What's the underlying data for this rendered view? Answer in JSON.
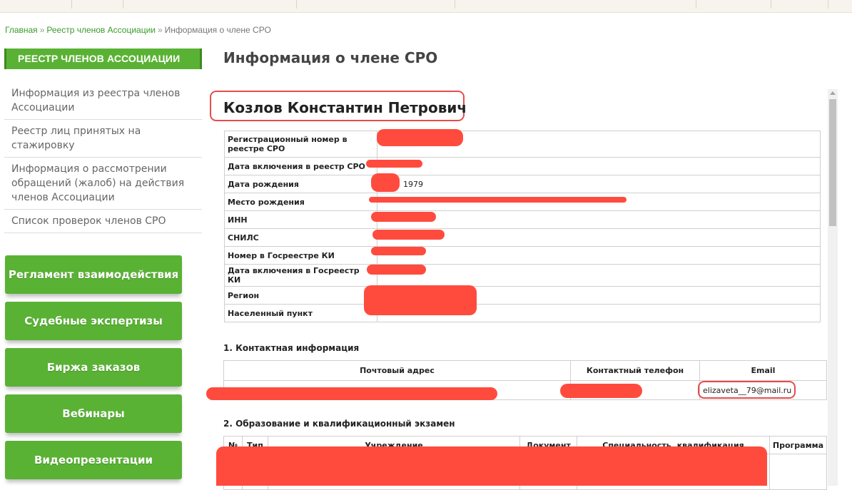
{
  "breadcrumb": {
    "home": "Главная",
    "registry": "Реестр членов Ассоциации",
    "current": "Информация о члене СРО",
    "separator": "»"
  },
  "sidebar": {
    "header": "РЕЕСТР ЧЛЕНОВ АССОЦИАЦИИ",
    "items": [
      {
        "label": "Информация из реестра членов Ассоциации"
      },
      {
        "label": "Реестр лиц принятых на стажировку"
      },
      {
        "label": "Информация о рассмотрении обращений (жалоб) на действия членов Ассоциации"
      },
      {
        "label": "Список проверок членов СРО"
      }
    ],
    "buttons": [
      {
        "label": "Регламент взаимодействия"
      },
      {
        "label": "Судебные экспертизы"
      },
      {
        "label": "Биржа заказов"
      },
      {
        "label": "Вебинары"
      },
      {
        "label": "Видеопрезентации"
      }
    ]
  },
  "main": {
    "title": "Информация о члене СРО",
    "person_name": "Козлов Константин Петрович",
    "info_rows": [
      {
        "label": "Регистрационный номер в реестре СРО",
        "value": ""
      },
      {
        "label": "Дата включения в реестр СРО",
        "value": ""
      },
      {
        "label": "Дата рождения",
        "value": "1979"
      },
      {
        "label": "Место рождения",
        "value": ""
      },
      {
        "label": "ИНН",
        "value": ""
      },
      {
        "label": "СНИЛС",
        "value": ""
      },
      {
        "label": "Номер в Госреестре КИ",
        "value": ""
      },
      {
        "label": "Дата включения в Госреестр КИ",
        "value": ""
      },
      {
        "label": "Регион",
        "value": ""
      },
      {
        "label": "Населенный пункт",
        "value": ""
      }
    ],
    "contact_section": {
      "title": "1. Контактная информация",
      "headers": [
        "Почтовый адрес",
        "Контактный телефон",
        "Email"
      ],
      "email": "elizaveta__79@mail.ru"
    },
    "education_section": {
      "title": "2. Образование и квалификационный экзамен",
      "headers": [
        "№",
        "Тип",
        "Учреждение",
        "Документ",
        "Специальность, квалификация",
        "Программа"
      ]
    }
  },
  "colors": {
    "accent_green": "#5ab234",
    "link_green": "#3a9b2a",
    "redaction": "#ff4b3e",
    "highlight_outline": "#e74c4c"
  }
}
